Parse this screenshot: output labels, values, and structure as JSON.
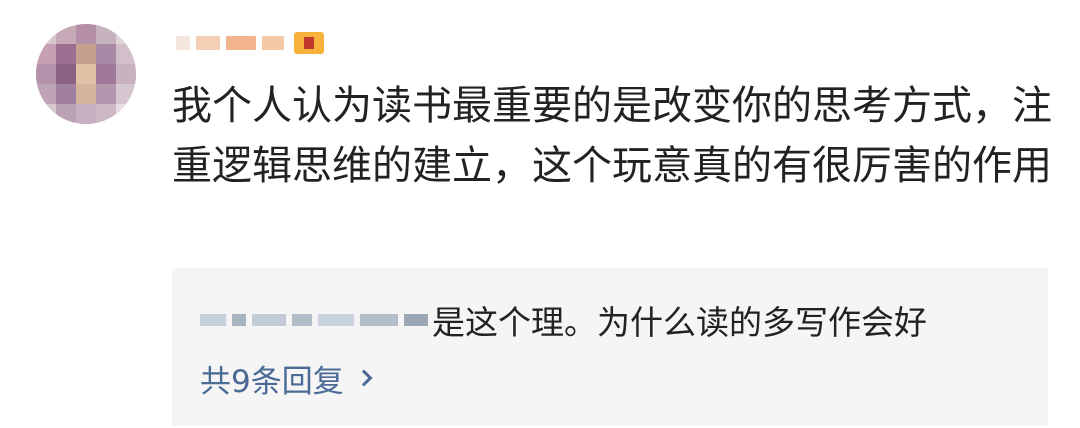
{
  "comment": {
    "body": "我个人认为读书最重要的是改变你的思考方式，注重逻辑思维的建立，这个玩意真的有很厉害的作用"
  },
  "reply_preview": {
    "text": "是这个理。为什么读的多写作会好",
    "count_label": "共9条回复",
    "link_color": "#4b6a96"
  },
  "icons": {
    "level_badge": "level-badge-icon",
    "more": "chevron-right-icon"
  }
}
